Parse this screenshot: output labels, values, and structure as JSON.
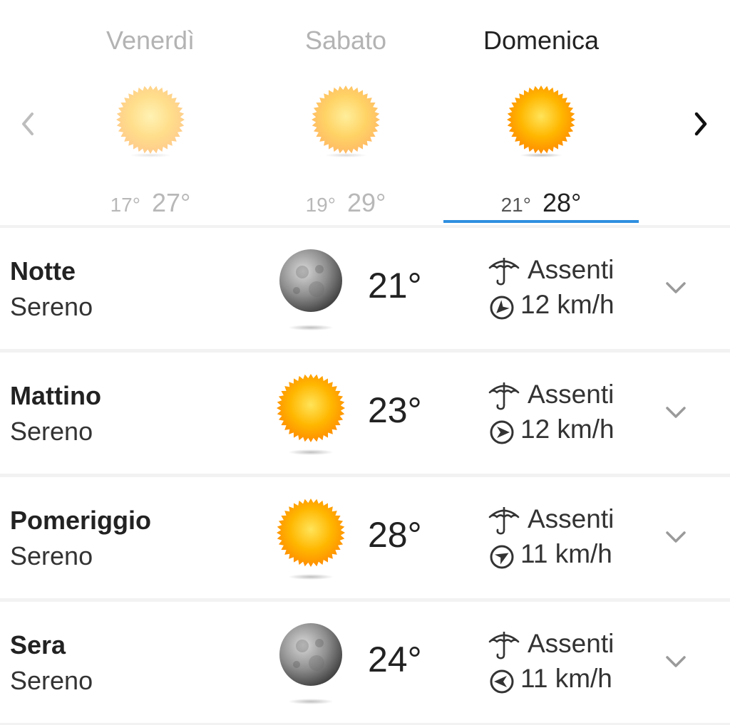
{
  "days": [
    {
      "name": "Venerdì",
      "min": "17°",
      "max": "27°",
      "icon": "sun-icon",
      "active": false
    },
    {
      "name": "Sabato",
      "min": "19°",
      "max": "29°",
      "icon": "sun-icon",
      "active": false
    },
    {
      "name": "Domenica",
      "min": "21°",
      "max": "28°",
      "icon": "sun-icon",
      "active": true
    }
  ],
  "nav": {
    "prev_icon": "chevron-left-icon",
    "next_icon": "chevron-right-icon"
  },
  "periods": [
    {
      "name": "Notte",
      "condition": "Sereno",
      "icon": "moon-icon",
      "temp": "21°",
      "precip": "Assenti",
      "wind": "12 km/h",
      "wind_icon": "wind-direction-icon"
    },
    {
      "name": "Mattino",
      "condition": "Sereno",
      "icon": "sun-icon",
      "temp": "23°",
      "precip": "Assenti",
      "wind": "12 km/h",
      "wind_icon": "wind-direction-icon"
    },
    {
      "name": "Pomeriggio",
      "condition": "Sereno",
      "icon": "sun-icon",
      "temp": "28°",
      "precip": "Assenti",
      "wind": "11 km/h",
      "wind_icon": "wind-direction-icon"
    },
    {
      "name": "Sera",
      "condition": "Sereno",
      "icon": "moon-icon",
      "temp": "24°",
      "precip": "Assenti",
      "wind": "11 km/h",
      "wind_icon": "wind-direction-icon"
    }
  ],
  "colors": {
    "accent": "#2f8fe0",
    "sun": "#ffa800",
    "moon": "#888888"
  }
}
